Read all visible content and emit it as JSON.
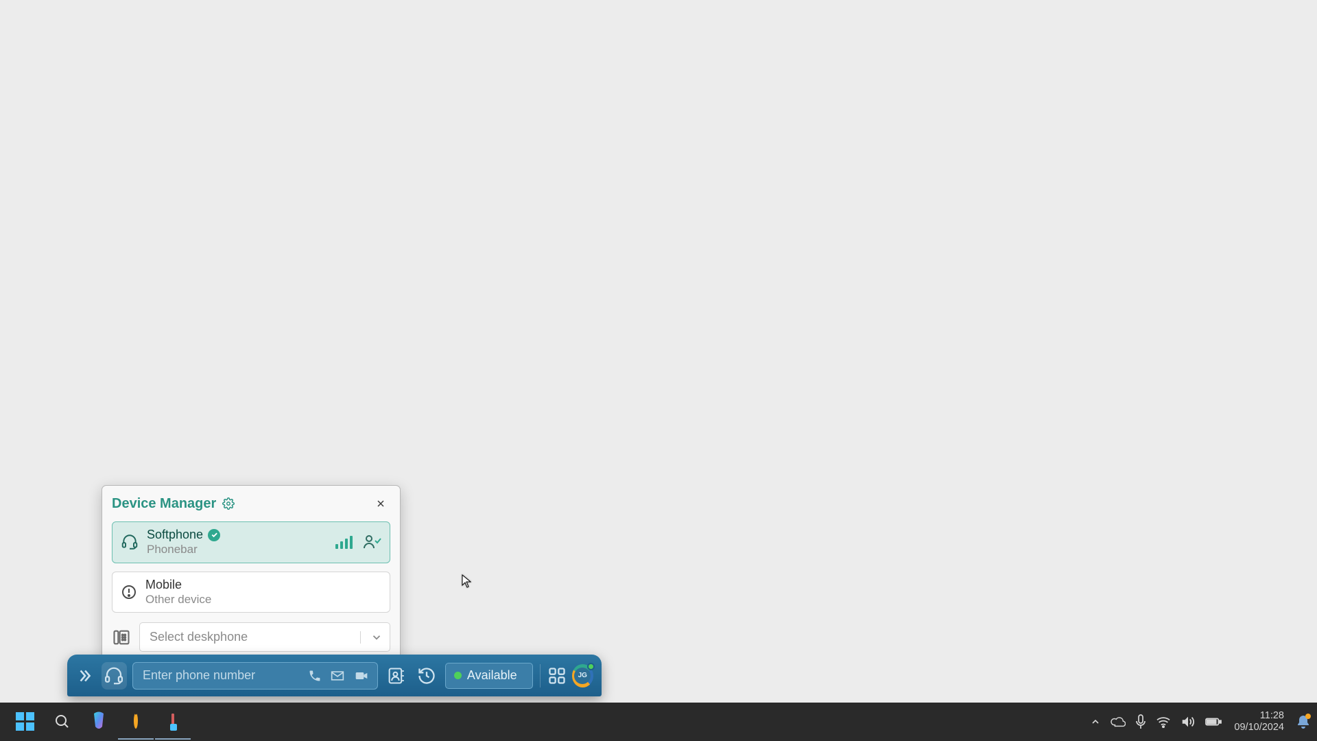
{
  "device_manager": {
    "title": "Device Manager",
    "devices": [
      {
        "name": "Softphone",
        "sub": "Phonebar"
      },
      {
        "name": "Mobile",
        "sub": "Other device"
      }
    ],
    "deskphone_placeholder": "Select deskphone"
  },
  "phonebar": {
    "phone_placeholder": "Enter phone number",
    "status_label": "Available",
    "avatar_initials": "JG"
  },
  "taskbar": {
    "time": "11:28",
    "date": "09/10/2024"
  }
}
